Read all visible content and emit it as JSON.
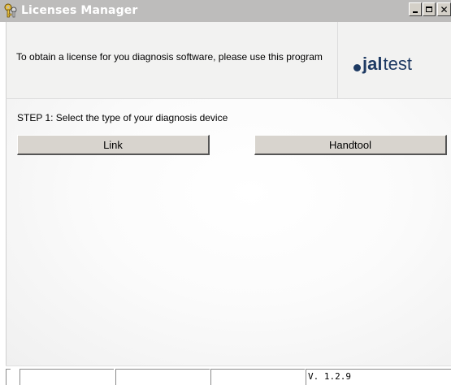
{
  "window": {
    "title": "Licenses Manager"
  },
  "header": {
    "message": "To obtain a license for you diagnosis software, please use this program",
    "logo_bold": "jal",
    "logo_light": "test"
  },
  "main": {
    "step_label": "STEP 1: Select the type of your diagnosis device",
    "buttons": [
      {
        "label": "Link"
      },
      {
        "label": "Handtool"
      }
    ]
  },
  "status_bar": {
    "version": "V. 1.2.9"
  },
  "colors": {
    "titlebar": "#bdbcbb",
    "logo": "#1e3a63",
    "button_face": "#d8d4ce"
  }
}
